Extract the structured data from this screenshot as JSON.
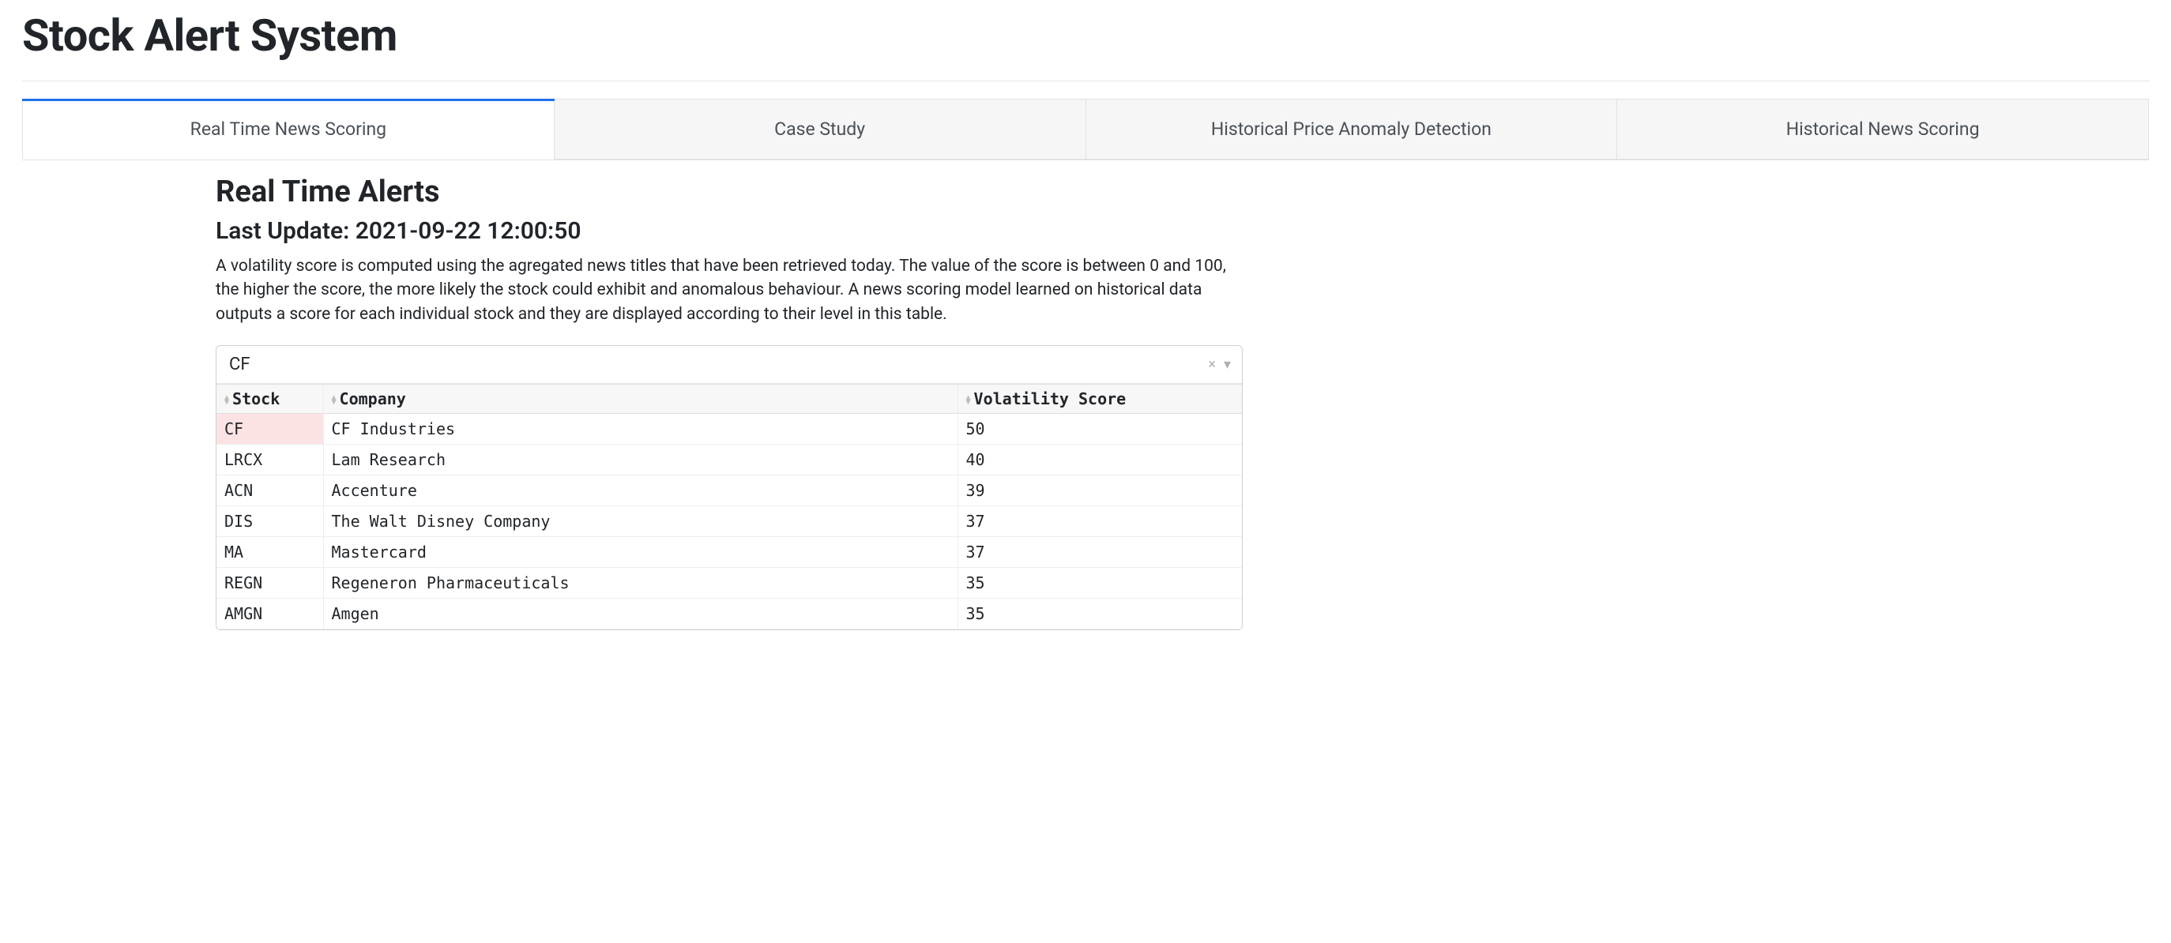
{
  "page": {
    "title": "Stock Alert System"
  },
  "tabs": [
    {
      "label": "Real Time News Scoring",
      "active": true
    },
    {
      "label": "Case Study",
      "active": false
    },
    {
      "label": "Historical Price Anomaly Detection",
      "active": false
    },
    {
      "label": "Historical News Scoring",
      "active": false
    }
  ],
  "section": {
    "title": "Real Time Alerts",
    "last_update_prefix": "Last Update: ",
    "last_update_value": "2021-09-22 12:00:50",
    "description": "A volatility score is computed using the agregated news titles that have been retrieved today. The value of the score is between 0 and 100, the higher the score, the more likely the stock could exhibit and anomalous behaviour. A news scoring model learned on historical data outputs a score for each individual stock and they are displayed according to their level in this table."
  },
  "filter": {
    "value": "CF",
    "clear_icon": "×",
    "dropdown_icon": "▾"
  },
  "table": {
    "columns": [
      {
        "key": "stock",
        "label": "Stock"
      },
      {
        "key": "company",
        "label": "Company"
      },
      {
        "key": "score",
        "label": "Volatility Score"
      }
    ],
    "rows": [
      {
        "stock": "CF",
        "company": "CF Industries",
        "score": 50,
        "highlight": true
      },
      {
        "stock": "LRCX",
        "company": "Lam Research",
        "score": 40
      },
      {
        "stock": "ACN",
        "company": "Accenture",
        "score": 39
      },
      {
        "stock": "DIS",
        "company": "The Walt Disney Company",
        "score": 37
      },
      {
        "stock": "MA",
        "company": "Mastercard",
        "score": 37
      },
      {
        "stock": "REGN",
        "company": "Regeneron Pharmaceuticals",
        "score": 35
      },
      {
        "stock": "AMGN",
        "company": "Amgen",
        "score": 35
      }
    ]
  }
}
